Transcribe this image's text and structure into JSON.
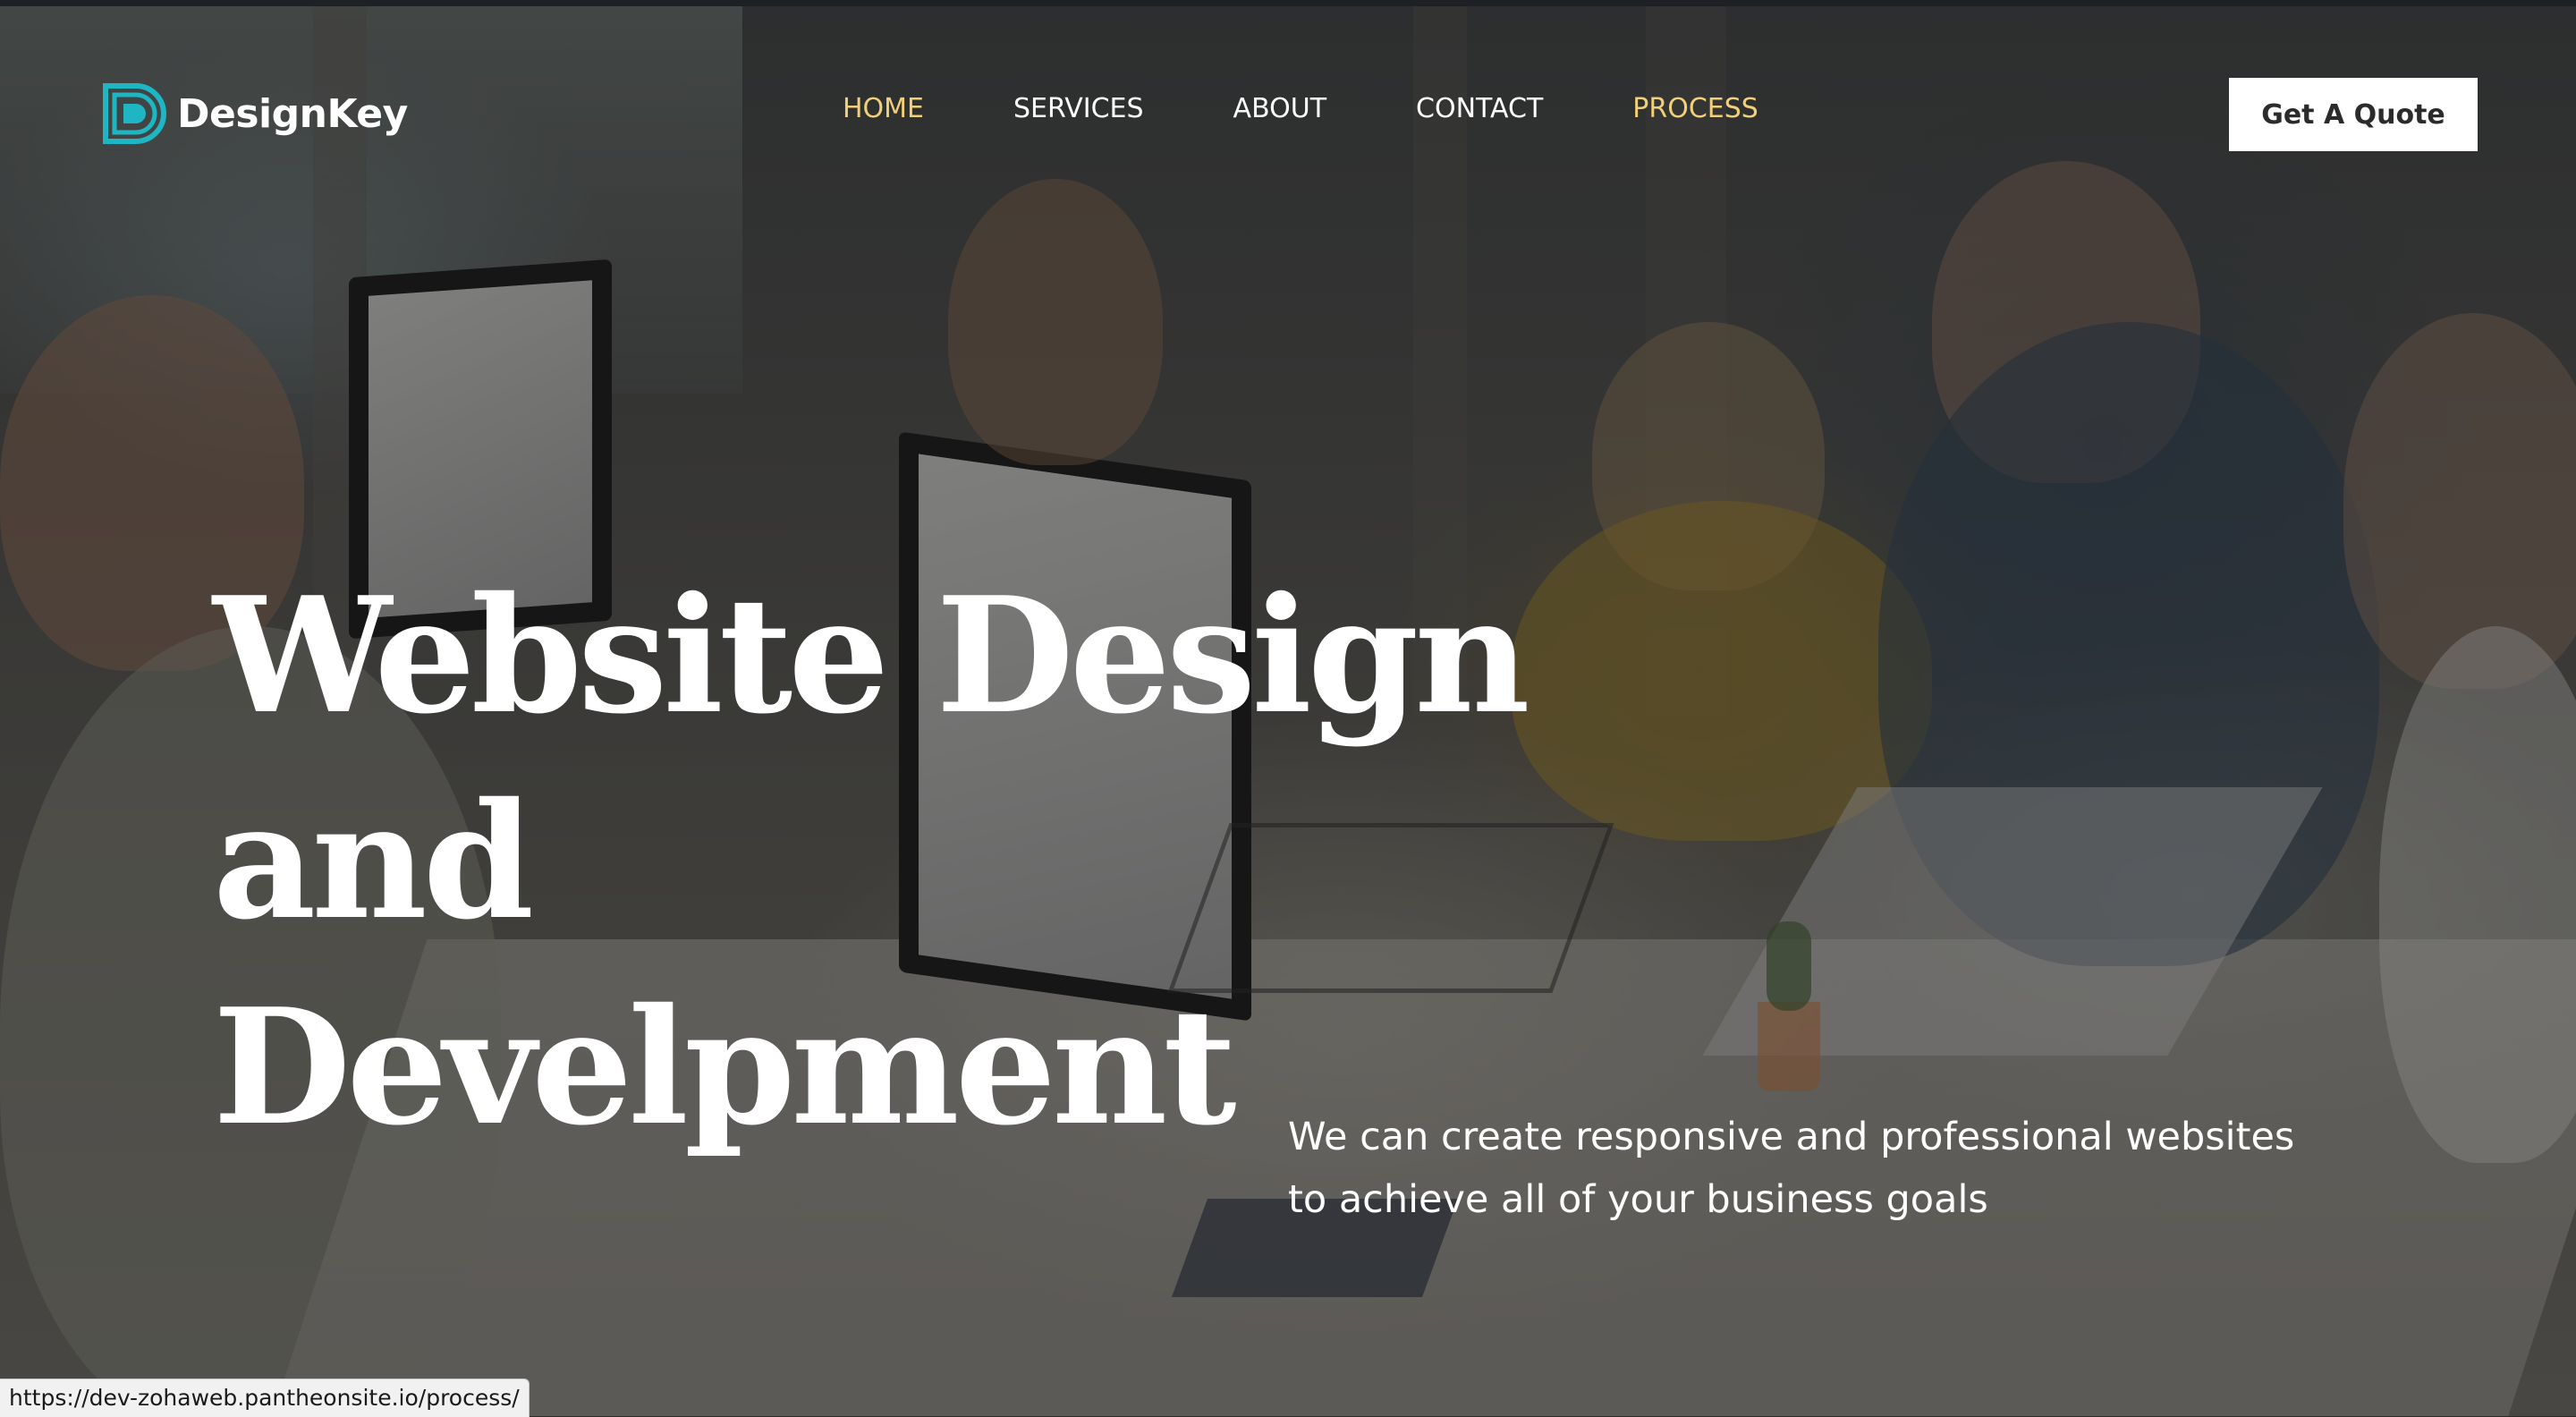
{
  "brand": {
    "name": "DesignKey",
    "logo_icon": "designkey-d-logo-icon",
    "accent_color": "#1fb6c3"
  },
  "nav": {
    "items": [
      {
        "label": "HOME",
        "active": true
      },
      {
        "label": "SERVICES",
        "active": false
      },
      {
        "label": "ABOUT",
        "active": false
      },
      {
        "label": "CONTACT",
        "active": false
      },
      {
        "label": "PROCESS",
        "active": true
      }
    ],
    "active_color": "#f2cf79"
  },
  "cta": {
    "label": "Get A Quote"
  },
  "hero": {
    "headline_line1": "Website Design and",
    "headline_line2": "Develpment",
    "tagline_line1": "We can create responsive and professional websites",
    "tagline_line2": "to achieve all of your business goals"
  },
  "status_bar": {
    "url": "https://dev-zohaweb.pantheonsite.io/process/"
  }
}
